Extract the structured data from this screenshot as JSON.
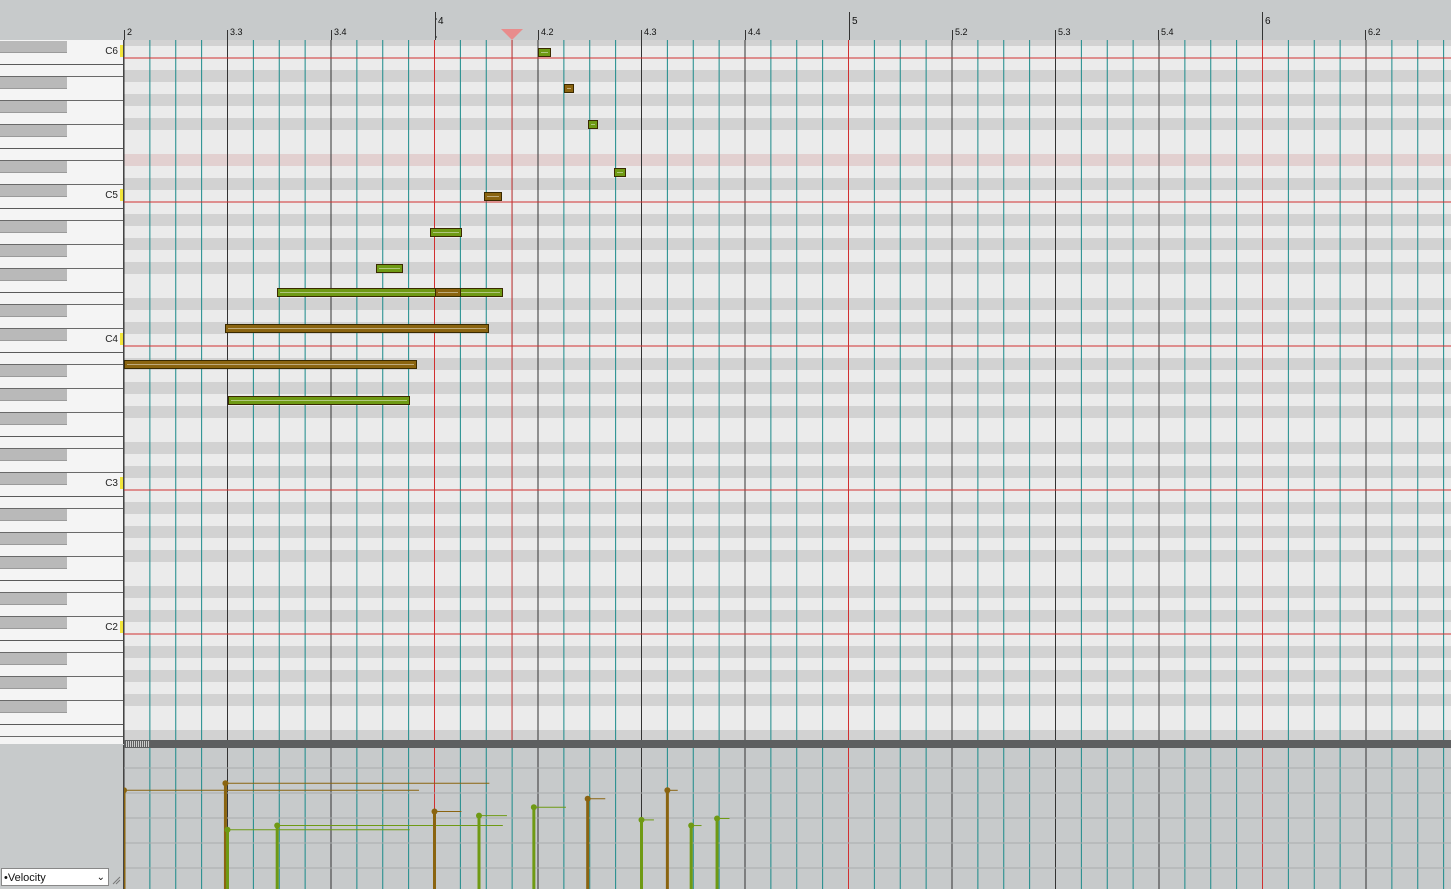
{
  "ruler": {
    "labels": [
      "2",
      "3.3",
      "3.4",
      "4",
      "4.2",
      "4.3",
      "4.4",
      "5",
      "5.2",
      "5.3",
      "5.4",
      "6",
      "6.2"
    ]
  },
  "keyboard": {
    "octave_labels": [
      "C6",
      "C5",
      "C4",
      "C3",
      "C2"
    ]
  },
  "notes": [
    {
      "pitch": 84,
      "start": 6.0,
      "end": 6.125,
      "color": "#6f9a14"
    },
    {
      "pitch": 81,
      "start": 6.25,
      "end": 6.35,
      "color": "#8a6410"
    },
    {
      "pitch": 78,
      "start": 6.48,
      "end": 6.58,
      "color": "#6f9a14"
    },
    {
      "pitch": 74,
      "start": 6.73,
      "end": 6.85,
      "color": "#6f9a14"
    },
    {
      "pitch": 72,
      "start": 5.48,
      "end": 5.65,
      "color": "#8a6410"
    },
    {
      "pitch": 69,
      "start": 4.96,
      "end": 5.27,
      "color": "#6f9a14"
    },
    {
      "pitch": 66,
      "start": 4.43,
      "end": 4.7,
      "color": "#6f9a14"
    },
    {
      "pitch": 64,
      "start": 3.48,
      "end": 5.66,
      "color": "#6f9a14"
    },
    {
      "pitch": 61,
      "start": 2.98,
      "end": 5.53,
      "color": "#8a6410"
    },
    {
      "pitch": 58,
      "start": 2.0,
      "end": 4.83,
      "color": "#8a6410"
    },
    {
      "pitch": 55,
      "start": 3.0,
      "end": 4.76,
      "color": "#6f9a14"
    },
    {
      "pitch": 64,
      "start": 5.0,
      "end": 5.26,
      "color": "#8a6410"
    }
  ],
  "velocity": [
    {
      "x": 2.0,
      "v": 0.7,
      "end": 4.85,
      "color": "#8a6410"
    },
    {
      "x": 2.98,
      "v": 0.75,
      "end": 5.53,
      "color": "#8a6410"
    },
    {
      "x": 3.0,
      "v": 0.42,
      "end": 4.76,
      "color": "#6f9a14"
    },
    {
      "x": 3.48,
      "v": 0.45,
      "end": 5.66,
      "color": "#6f9a14"
    },
    {
      "x": 5.0,
      "v": 0.55,
      "end": 5.26,
      "color": "#8a6410"
    },
    {
      "x": 5.43,
      "v": 0.52,
      "end": 5.7,
      "color": "#6f9a14"
    },
    {
      "x": 5.96,
      "v": 0.58,
      "end": 6.27,
      "color": "#6f9a14"
    },
    {
      "x": 6.48,
      "v": 0.64,
      "end": 6.65,
      "color": "#8a6410"
    },
    {
      "x": 7.0,
      "v": 0.49,
      "end": 7.12,
      "color": "#6f9a14"
    },
    {
      "x": 7.25,
      "v": 0.7,
      "end": 7.35,
      "color": "#8a6410"
    },
    {
      "x": 7.48,
      "v": 0.45,
      "end": 7.58,
      "color": "#6f9a14"
    },
    {
      "x": 7.73,
      "v": 0.5,
      "end": 7.85,
      "color": "#6f9a14"
    }
  ],
  "colors": {
    "grid_line": "#1a8a8a",
    "beat_line": "#333333",
    "bar_line": "#d03030",
    "octave_line": "#d03030",
    "row_light": "#ebebeb",
    "row_dark": "#d2d2d2",
    "row_highlight": "#e2d0d0"
  },
  "lane": {
    "selected": "•Velocity"
  }
}
